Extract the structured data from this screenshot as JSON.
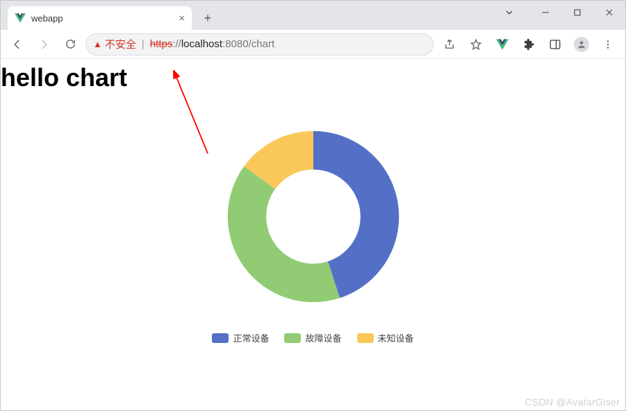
{
  "window": {
    "tab_title": "webapp"
  },
  "address_bar": {
    "security_label": "不安全",
    "url_https": "https",
    "url_sep": "://",
    "url_host": "localhost",
    "url_port": ":8080",
    "url_path": "/chart"
  },
  "page": {
    "heading": "hello chart"
  },
  "chart_data": {
    "type": "pie",
    "variant": "donut",
    "title": "",
    "series": [
      {
        "name": "正常设备",
        "value": 45,
        "color": "#5470c6"
      },
      {
        "name": "故障设备",
        "value": 40,
        "color": "#91cc75"
      },
      {
        "name": "未知设备",
        "value": 15,
        "color": "#fac858"
      }
    ],
    "legend_position": "bottom",
    "inner_radius_pct": 55
  },
  "watermark": "CSDN @AvatarGiser"
}
